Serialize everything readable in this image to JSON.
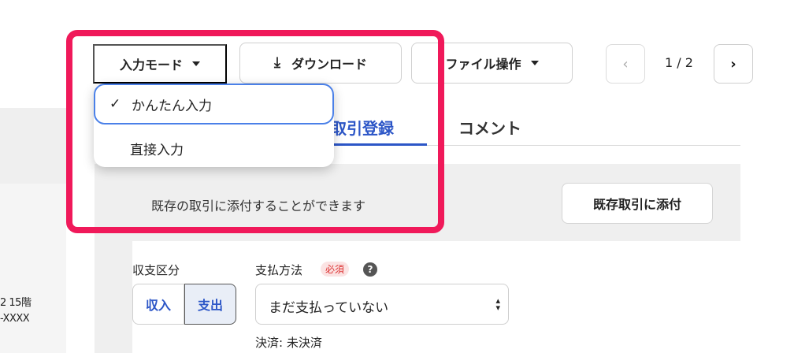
{
  "toolbar": {
    "mode_label": "入力モード",
    "download_label": "ダウンロード",
    "file_label": "ファイル操作",
    "page_indicator": "1 / 2"
  },
  "dropdown": {
    "items": [
      {
        "label": "かんたん入力",
        "checked": true
      },
      {
        "label": "直接入力",
        "checked": false
      }
    ]
  },
  "tabs": {
    "register": "取引登録",
    "comment": "コメント"
  },
  "notice": {
    "text": "既存の取引に添付することができます",
    "button": "既存取引に添付"
  },
  "form": {
    "category_label": "収支区分",
    "income": "収入",
    "expense": "支出",
    "payment_label": "支払方法",
    "required": "必須",
    "help": "?",
    "payment_value": "まだ支払っていない",
    "settlement_text": "決済: 未決済"
  },
  "left_preview": {
    "line1": "2 15階",
    "line2": "-XXXX"
  },
  "colors": {
    "accent": "#2c56c7",
    "highlight": "#f0195a",
    "focus": "#4a80e8"
  }
}
